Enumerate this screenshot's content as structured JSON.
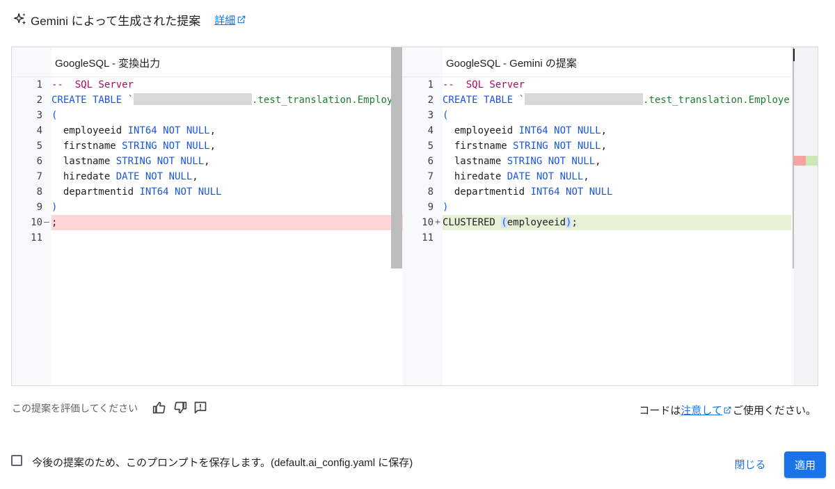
{
  "header": {
    "title": "Gemini によって生成された提案",
    "details_link": "詳細"
  },
  "diff": {
    "left": {
      "title": "GoogleSQL - 変換出力",
      "line_numbers": [
        "1",
        "2",
        "3",
        "4",
        "5",
        "6",
        "7",
        "8",
        "9",
        "10",
        "11"
      ],
      "removed_marker": "—",
      "lines": {
        "l1_comment": "--  SQL Server",
        "l2_kw": "CREATE TABLE `",
        "l2_tail": ".test_translation.Employe",
        "l3": "(",
        "l4_name": "  employeeid ",
        "l4_type": "INT64 NOT NULL",
        "l4_end": ",",
        "l5_name": "  firstname ",
        "l5_type": "STRING NOT NULL",
        "l5_end": ",",
        "l6_name": "  lastname ",
        "l6_type": "STRING NOT NULL",
        "l6_end": ",",
        "l7_name": "  hiredate ",
        "l7_type": "DATE NOT NULL",
        "l7_end": ",",
        "l8_name": "  departmentid ",
        "l8_type": "INT64 NOT NULL",
        "l9": ")",
        "l10": ";"
      }
    },
    "right": {
      "title": "GoogleSQL - Gemini の提案",
      "line_numbers": [
        "1",
        "2",
        "3",
        "4",
        "5",
        "6",
        "7",
        "8",
        "9",
        "10",
        "11"
      ],
      "added_marker": "+",
      "lines": {
        "l1_comment": "--  SQL Server",
        "l2_kw": "CREATE TABLE `",
        "l2_tail": ".test_translation.Employe",
        "l3": "(",
        "l4_name": "  employeeid ",
        "l4_type": "INT64 NOT NULL",
        "l4_end": ",",
        "l5_name": "  firstname ",
        "l5_type": "STRING NOT NULL",
        "l5_end": ",",
        "l6_name": "  lastname ",
        "l6_type": "STRING NOT NULL",
        "l6_end": ",",
        "l7_name": "  hiredate ",
        "l7_type": "DATE NOT NULL",
        "l7_end": ",",
        "l8_name": "  departmentid ",
        "l8_type": "INT64 NOT NULL",
        "l9": ")",
        "l10_kw": "CLUSTERED ",
        "l10_open": "(",
        "l10_col": "employeeid",
        "l10_close": ")",
        "l10_end": ";"
      }
    }
  },
  "footer": {
    "rate_prompt": "この提案を評価してください",
    "code_note_pre": "コードは",
    "code_note_link": "注意して",
    "code_note_post": "ご使用ください。",
    "save_prompt_label": "今後の提案のため、このプロンプトを保存します。(default.ai_config.yaml に保存)",
    "close_button": "閉じる",
    "apply_button": "適用"
  },
  "icons": {
    "sparkle": "sparkle-icon",
    "external_link": "open-in-new-icon",
    "thumbs_up": "thumbs-up-icon",
    "thumbs_down": "thumbs-down-icon",
    "report": "feedback-icon"
  },
  "colors": {
    "accent": "#1a73e8",
    "removed_line": "#ffd6d3",
    "added_line": "#e6f1d6",
    "keyword": "#1a56db",
    "comment": "#b5095f",
    "string": "#1e7e34"
  }
}
